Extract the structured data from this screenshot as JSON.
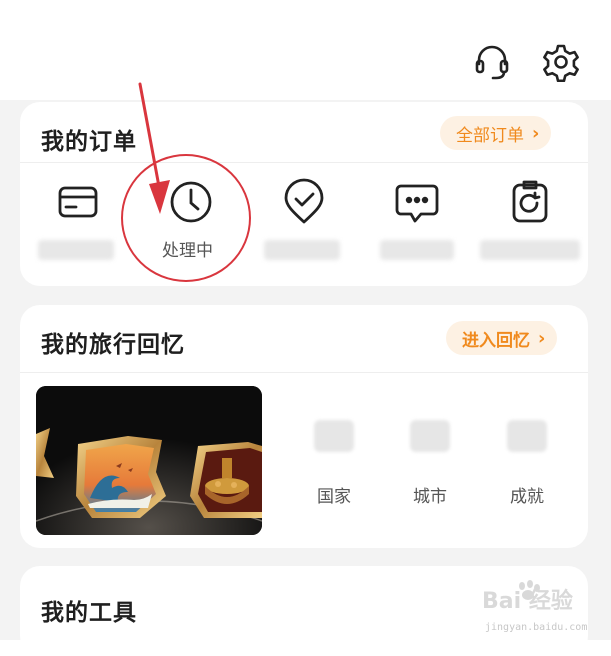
{
  "header": {
    "support_icon": "headset-icon",
    "settings_icon": "gear-icon"
  },
  "orders": {
    "title": "我的订单",
    "all_orders_label": "全部订单",
    "items": [
      {
        "icon": "card-icon",
        "label": ""
      },
      {
        "icon": "clock-icon",
        "label": "处理中"
      },
      {
        "icon": "check-pin-icon",
        "label": ""
      },
      {
        "icon": "chat-bubble-icon",
        "label": ""
      },
      {
        "icon": "refund-icon",
        "label": ""
      }
    ]
  },
  "memory": {
    "title": "我的旅行回忆",
    "enter_label": "进入回忆",
    "stats": [
      {
        "label": "国家"
      },
      {
        "label": "城市"
      },
      {
        "label": "成就"
      }
    ]
  },
  "tools": {
    "title": "我的工具"
  },
  "watermark": {
    "text": "jingyan.baidu.com",
    "brand": "Bai 经验"
  },
  "colors": {
    "accent": "#f08a1e",
    "pill_bg": "#fdf1e3",
    "annotation": "#d9363e"
  }
}
